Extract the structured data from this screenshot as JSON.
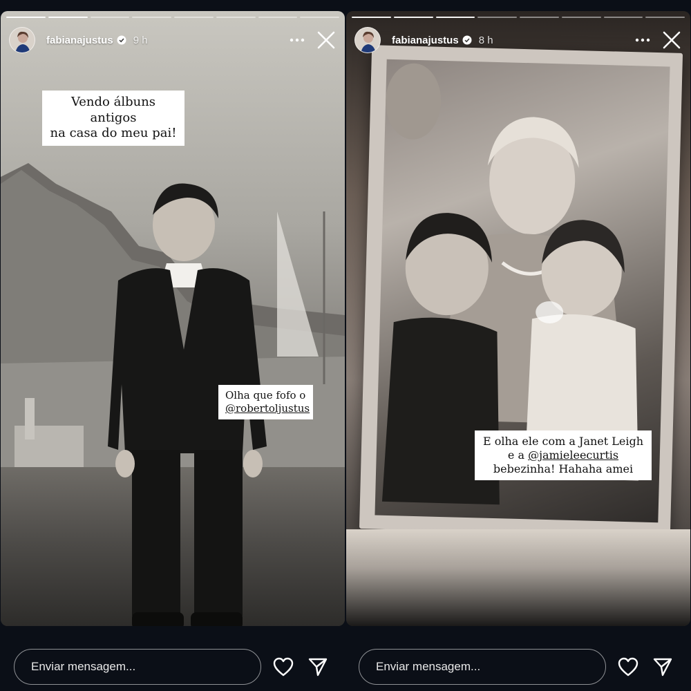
{
  "stories": [
    {
      "username": "fabianajustus",
      "time": "9 h",
      "progress": {
        "segments": 8,
        "completed": 2
      },
      "captions": {
        "top": [
          "Vendo álbuns antigos",
          "na casa do meu pai!"
        ],
        "side": {
          "text": "Olha que fofo o",
          "mention": "@robertoljustus"
        }
      },
      "reply_placeholder": "Enviar mensagem..."
    },
    {
      "username": "fabianajustus",
      "time": "8 h",
      "progress": {
        "segments": 8,
        "completed": 3
      },
      "captions": {
        "bottom": {
          "line1": "E olha ele com a Janet Leigh",
          "line2_prefix": "e a ",
          "line2_mention": "@jamieleecurtis",
          "line3": "bebezinha! Hahaha amei"
        }
      },
      "reply_placeholder": "Enviar mensagem..."
    }
  ],
  "icons": {
    "verified": "verified-badge-icon",
    "more": "more-options-icon",
    "close": "close-icon",
    "like": "heart-icon",
    "share": "send-icon"
  },
  "colors": {
    "background": "#0b0f17",
    "caption_bg": "#ffffff",
    "verified_blue": "#3897f0"
  }
}
